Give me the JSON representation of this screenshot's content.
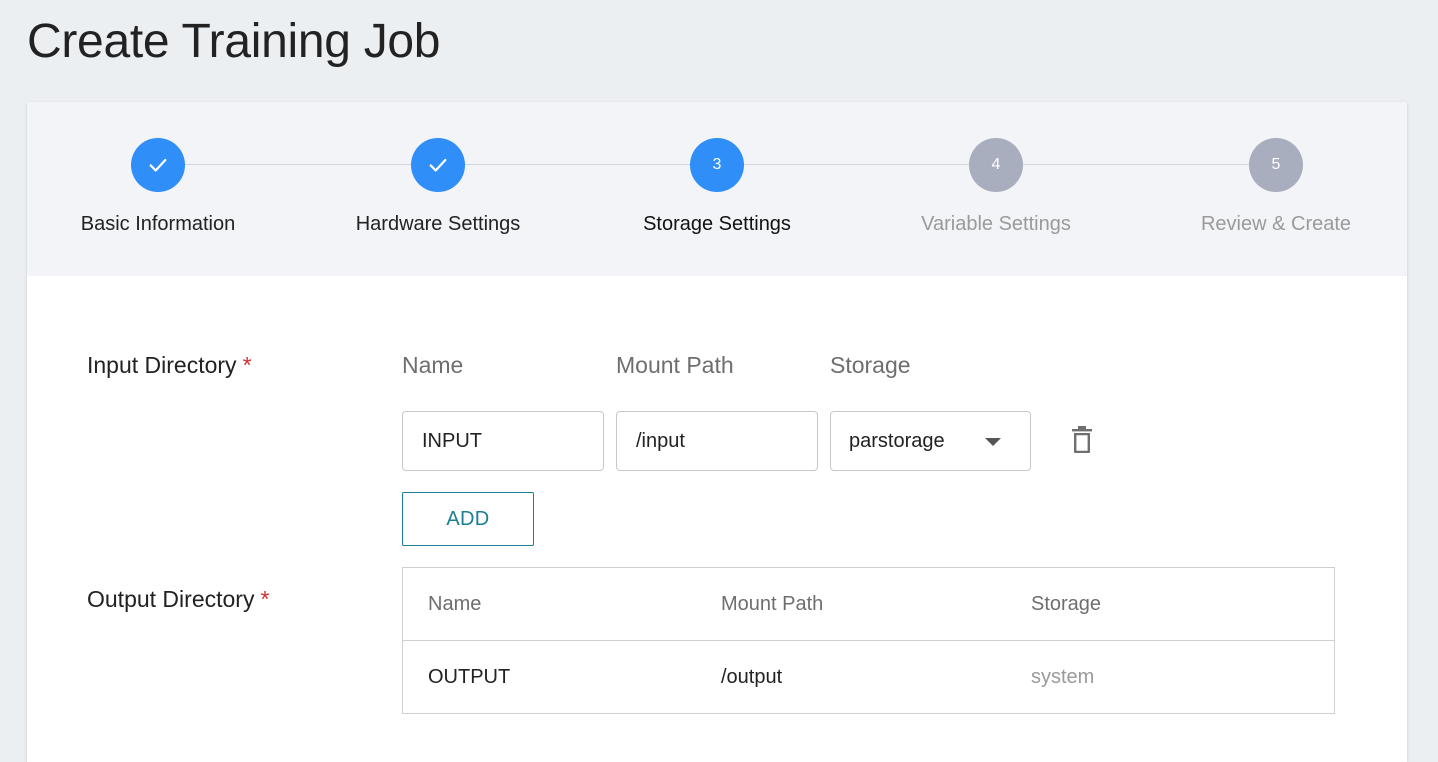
{
  "page": {
    "title": "Create Training Job"
  },
  "stepper": {
    "steps": [
      {
        "label": "Basic Information",
        "status": "completed",
        "indicator": "check-icon"
      },
      {
        "label": "Hardware Settings",
        "status": "completed",
        "indicator": "check-icon"
      },
      {
        "label": "Storage Settings",
        "status": "current",
        "number": "3"
      },
      {
        "label": "Variable Settings",
        "status": "pending",
        "number": "4"
      },
      {
        "label": "Review & Create",
        "status": "pending",
        "number": "5"
      }
    ],
    "colors": {
      "active": "#2f8ef8",
      "pending": "#a9aebf"
    }
  },
  "input_directory": {
    "label": "Input Directory",
    "required_mark": "*",
    "columns": [
      "Name",
      "Mount Path",
      "Storage"
    ],
    "rows": [
      {
        "name": "INPUT",
        "mount_path": "/input",
        "storage": "parstorage",
        "delete_icon": "trash-icon"
      }
    ],
    "add_label": "ADD"
  },
  "output_directory": {
    "label": "Output Directory",
    "required_mark": "*",
    "columns": [
      "Name",
      "Mount Path",
      "Storage"
    ],
    "rows": [
      {
        "name": "OUTPUT",
        "mount_path": "/output",
        "storage": "system"
      }
    ]
  },
  "colors": {
    "accent": "#1a7f95",
    "required": "#d32f2f"
  }
}
